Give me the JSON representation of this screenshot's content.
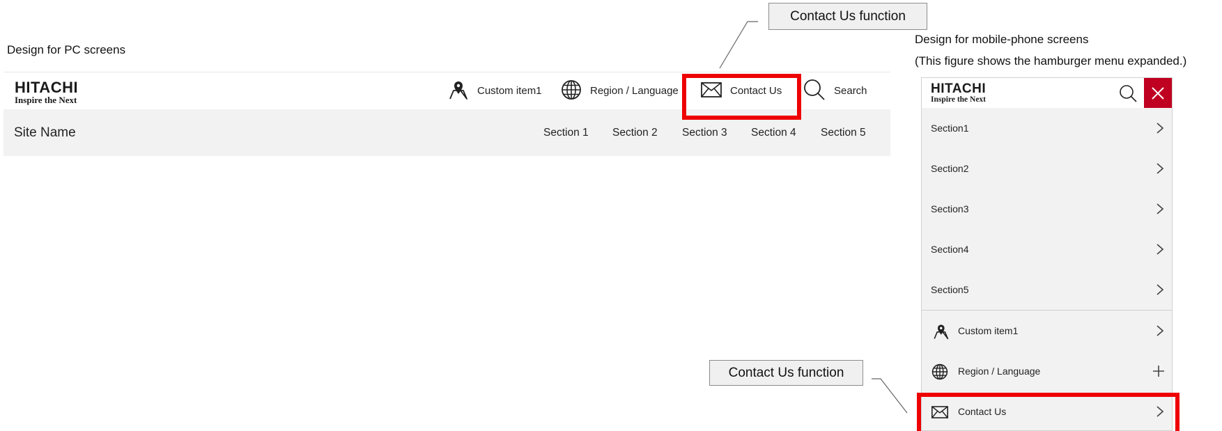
{
  "captions": {
    "pc": "Design for PC screens",
    "mobile_line1": "Design for mobile-phone screens",
    "mobile_line2": "(This figure shows the hamburger menu expanded.)"
  },
  "logo": {
    "brand": "HITACHI",
    "tagline": "Inspire the Next"
  },
  "pc": {
    "utility_nav": [
      {
        "label": "Custom item1",
        "icon": "map-pin-icon"
      },
      {
        "label": "Region / Language",
        "icon": "globe-icon"
      },
      {
        "label": "Contact Us",
        "icon": "mail-icon"
      },
      {
        "label": "Search",
        "icon": "search-icon"
      }
    ],
    "site_name": "Site Name",
    "sections": [
      "Section 1",
      "Section 2",
      "Section 3",
      "Section 4",
      "Section 5"
    ]
  },
  "mobile": {
    "sections": [
      "Section1",
      "Section2",
      "Section3",
      "Section4",
      "Section5"
    ],
    "utility": [
      {
        "label": "Custom item1",
        "icon": "map-pin-icon",
        "control": "chevron-right-icon"
      },
      {
        "label": "Region / Language",
        "icon": "globe-icon",
        "control": "plus-icon"
      },
      {
        "label": "Contact Us",
        "icon": "mail-icon",
        "control": "chevron-right-icon"
      }
    ]
  },
  "callouts": {
    "top": "Contact Us function",
    "bottom": "Contact Us function"
  },
  "colors": {
    "highlight": "#ee0000",
    "close_button": "#c00020",
    "bar_background": "#f2f2f2"
  }
}
